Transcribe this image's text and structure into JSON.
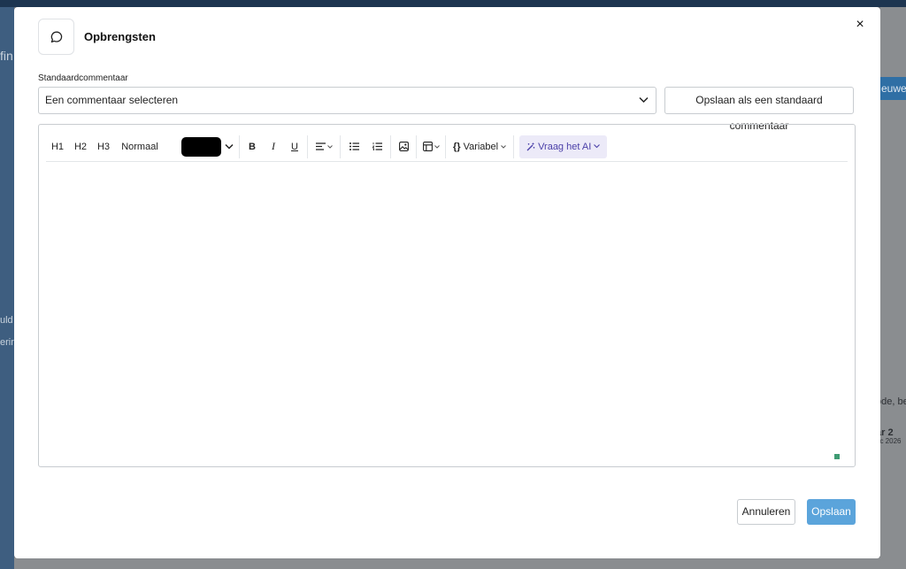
{
  "background": {
    "sidebar_texts": [
      "fin",
      "uld",
      "erin"
    ],
    "right_button": "euwe",
    "right_texts": [
      "ode, be",
      "ar 2",
      "ec 2026"
    ]
  },
  "modal": {
    "title": "Opbrengsten",
    "close_label": "×",
    "header_icon": "comment-icon",
    "standard_comment": {
      "label": "Standaardcommentaar",
      "select_value": "Een commentaar selecteren",
      "save_button": "Opslaan als een standaard commentaar"
    },
    "toolbar": {
      "h1": "H1",
      "h2": "H2",
      "h3": "H3",
      "paragraph": "Normaal",
      "text_color": "#000000",
      "bold": "B",
      "italic": "I",
      "underline": "U",
      "variable": "Variabel",
      "ai": "Vraag het AI"
    },
    "editor_content": "",
    "cancel_button": "Annuleren",
    "save_button": "Opslaan"
  },
  "colors": {
    "primary": "#5ba4db",
    "ai_accent": "#4a3fa8",
    "ai_bg": "#eceaf8"
  }
}
